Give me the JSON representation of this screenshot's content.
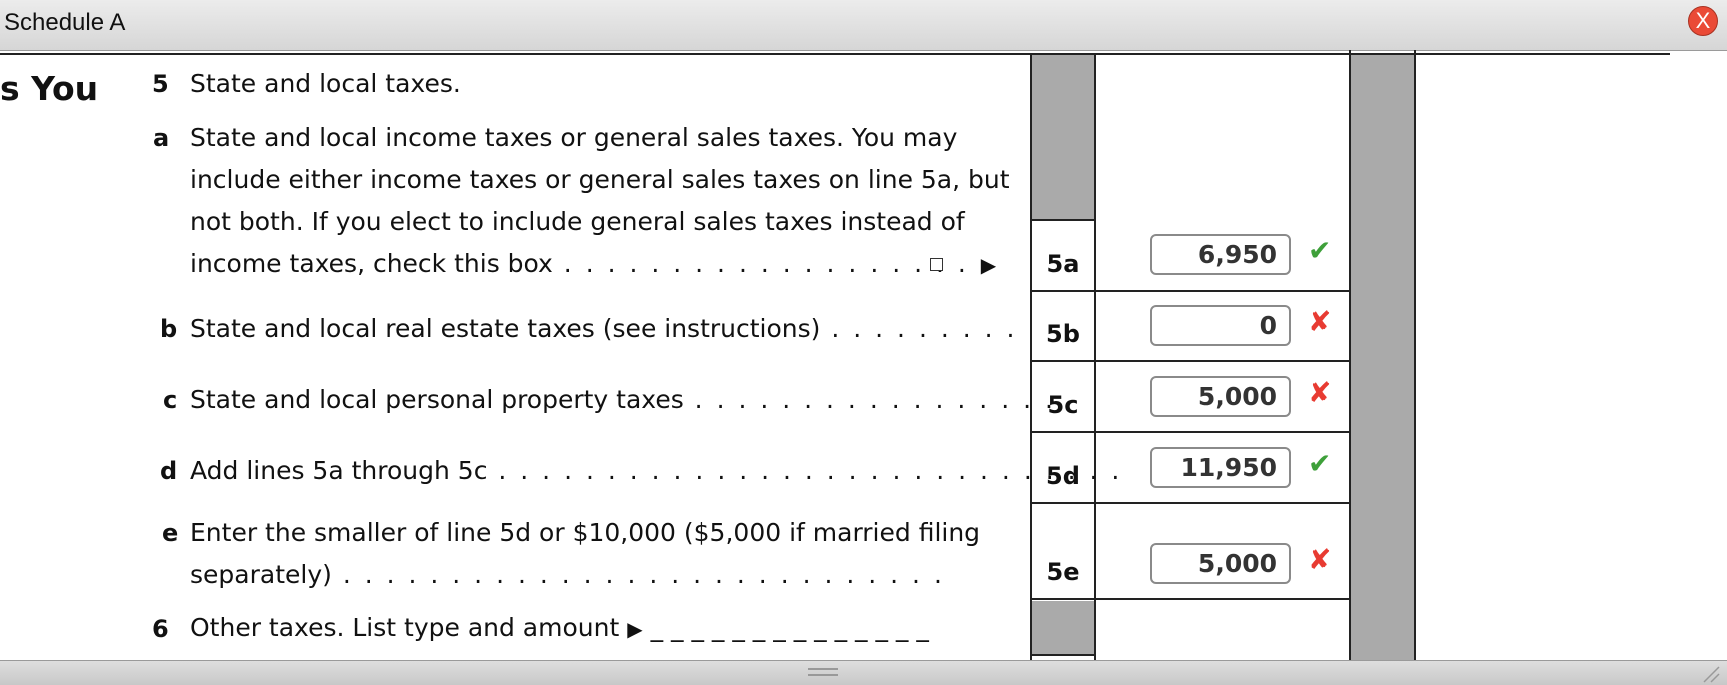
{
  "window": {
    "title": "Schedule A",
    "close_label": "X"
  },
  "section": {
    "heading": "s You"
  },
  "lines": {
    "l5": {
      "number": "5",
      "text": "State and local taxes."
    },
    "l5a": {
      "letter": "a",
      "text": [
        "State and local income taxes or general sales taxes. You may",
        "include either income taxes or general sales taxes on line 5a, but",
        "not both. If you elect to include general sales taxes instead of",
        "income taxes, check this box"
      ],
      "dots": " . . . . . . . . . . . . . . . . . . .",
      "arrow": "▶",
      "label": "5a",
      "amount": "6,950",
      "status": "✔"
    },
    "l5b": {
      "letter": "b",
      "text": "State and local real estate taxes (see instructions)",
      "dots": " . . . . . . . . .",
      "label": "5b",
      "amount": "0",
      "status": "✘"
    },
    "l5c": {
      "letter": "c",
      "text": "State and local personal property taxes",
      "dots": " . . . . . . . . . . . . . . . . .",
      "label": "5c",
      "amount": "5,000",
      "status": "✘"
    },
    "l5d": {
      "letter": "d",
      "text": "Add lines 5a through 5c",
      "dots": " . . . . . . . . . . . . . . . . . . . . . . . . . . . . .",
      "label": "5d",
      "amount": "11,950",
      "status": "✔"
    },
    "l5e": {
      "letter": "e",
      "text": [
        "Enter the smaller of line 5d or $10,000 ($5,000 if married filing",
        "separately)"
      ],
      "dots": " . . . . . . . . . . . . . . . . . . . . . . . . . . . .",
      "label": "5e",
      "amount": "5,000",
      "status": "✘"
    },
    "l6": {
      "number": "6",
      "text": "Other taxes. List type and amount",
      "arrow": "▶",
      "blank": "_ _ _ _ _ _ _ _ _ _ _ _ _ _"
    }
  }
}
